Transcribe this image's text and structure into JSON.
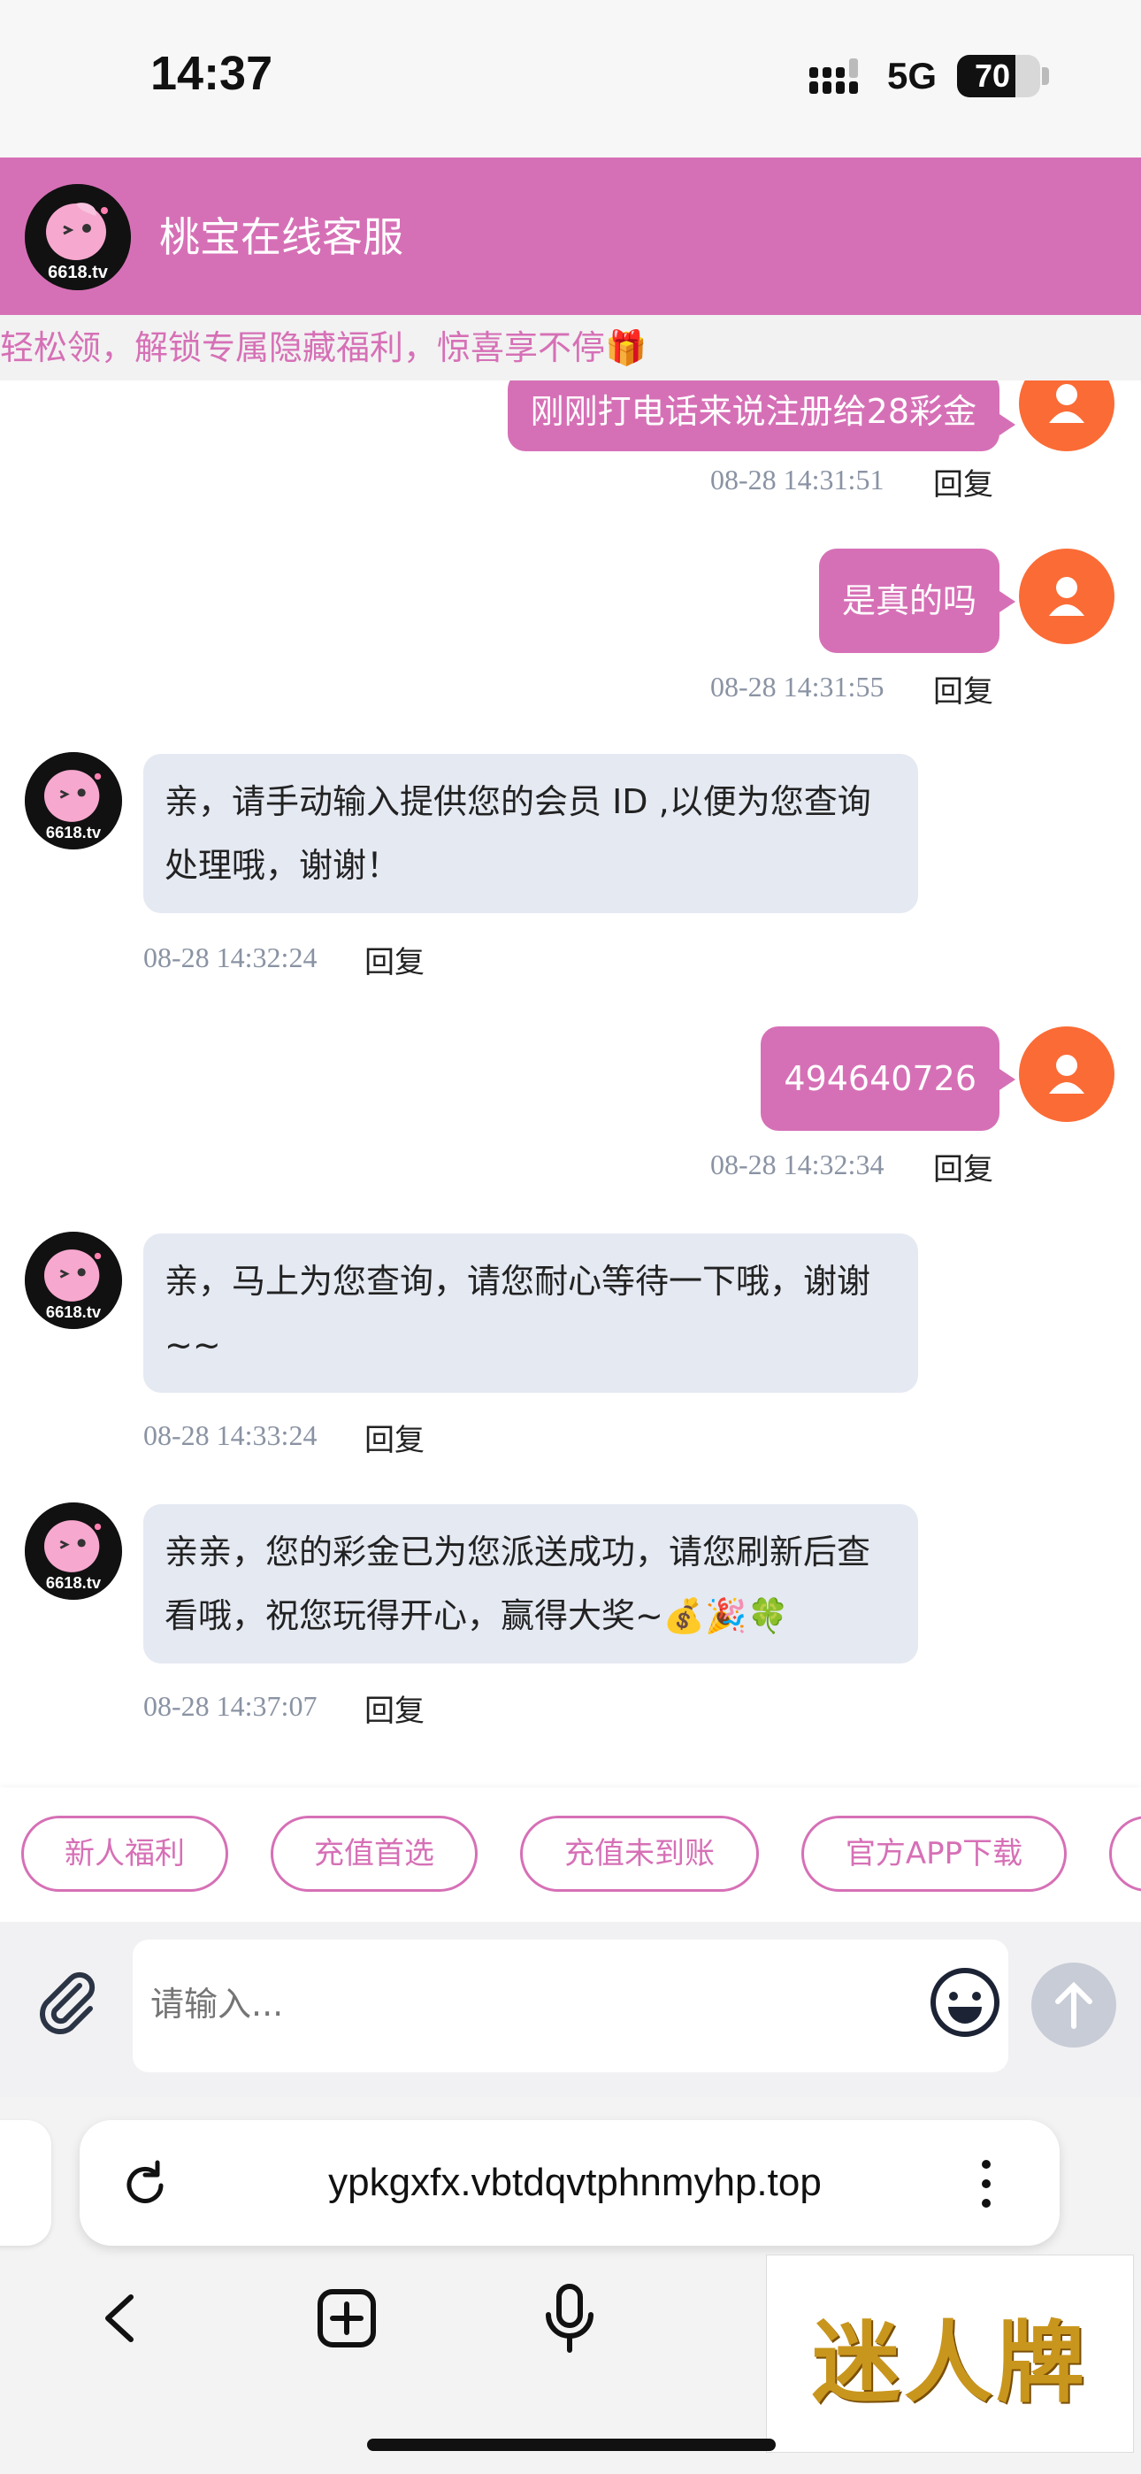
{
  "status_bar": {
    "time": "14:37",
    "network": "5G",
    "battery": "70",
    "battery_level": 0.7
  },
  "header": {
    "title": "桃宝在线客服",
    "avatar_label": "6618.tv"
  },
  "notice": {
    "text": "轻松领，解锁专属隐藏福利，惊喜享不停🎁"
  },
  "messages": [
    {
      "side": "user",
      "text": "刚刚打电话来说注册给28彩金",
      "time": "08-28 14:31:51",
      "reply": "回复"
    },
    {
      "side": "user",
      "text": "是真的吗",
      "time": "08-28 14:31:55",
      "reply": "回复"
    },
    {
      "side": "agent",
      "text": "亲，请手动输入提供您的会员 ID ,以便为您查询处理哦，谢谢！",
      "time": "08-28 14:32:24",
      "reply": "回复"
    },
    {
      "side": "user",
      "text": "494640726",
      "time": "08-28 14:32:34",
      "reply": "回复"
    },
    {
      "side": "agent",
      "text": "亲，马上为您查询，请您耐心等待一下哦，谢谢~~",
      "time": "08-28 14:33:24",
      "reply": "回复"
    },
    {
      "side": "agent",
      "text": "亲亲，您的彩金已为您派送成功，请您刷新后查看哦，祝您玩得开心，赢得大奖~💰🎉🍀",
      "time": "08-28 14:37:07",
      "reply": "回复"
    }
  ],
  "quick_replies": [
    "新人福利",
    "充值首选",
    "充值未到账",
    "官方APP下载"
  ],
  "input": {
    "placeholder": "请输入..."
  },
  "browser": {
    "url": "ypkgxfx.vbtdqvtphnmyhp.top"
  },
  "watermark": {
    "text": "迷人牌"
  }
}
